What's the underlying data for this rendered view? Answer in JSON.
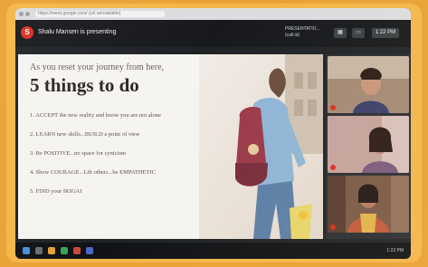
{
  "browser": {
    "url": "https://meet.google.com/ (url unreadable)"
  },
  "meet": {
    "presenter_initial": "S",
    "presenting_label": "Shalu Mansen is presenting",
    "call_info_line1": "PRESENTATIO...",
    "call_info_line2": "(call id)",
    "time": "1:22 PM"
  },
  "slide": {
    "subtitle": "As you reset your journey from here,",
    "title": "5 things to do",
    "items": [
      "1. ACCEPT the new reality and know you are not alone",
      "2. LEARN new skills...BUILD a point of view",
      "3. Be POSITIVE...no space for cynicism",
      "4. Show COURAGE...Lift others...be EMPATHETIC",
      "5. FIND your IKIGAI"
    ]
  },
  "participants": [
    {
      "name": "participant-1"
    },
    {
      "name": "participant-2"
    },
    {
      "name": "participant-3"
    }
  ],
  "colors": {
    "frame": "#f4b64a",
    "meet_dark": "#17191c",
    "mic_off": "#d93025"
  }
}
